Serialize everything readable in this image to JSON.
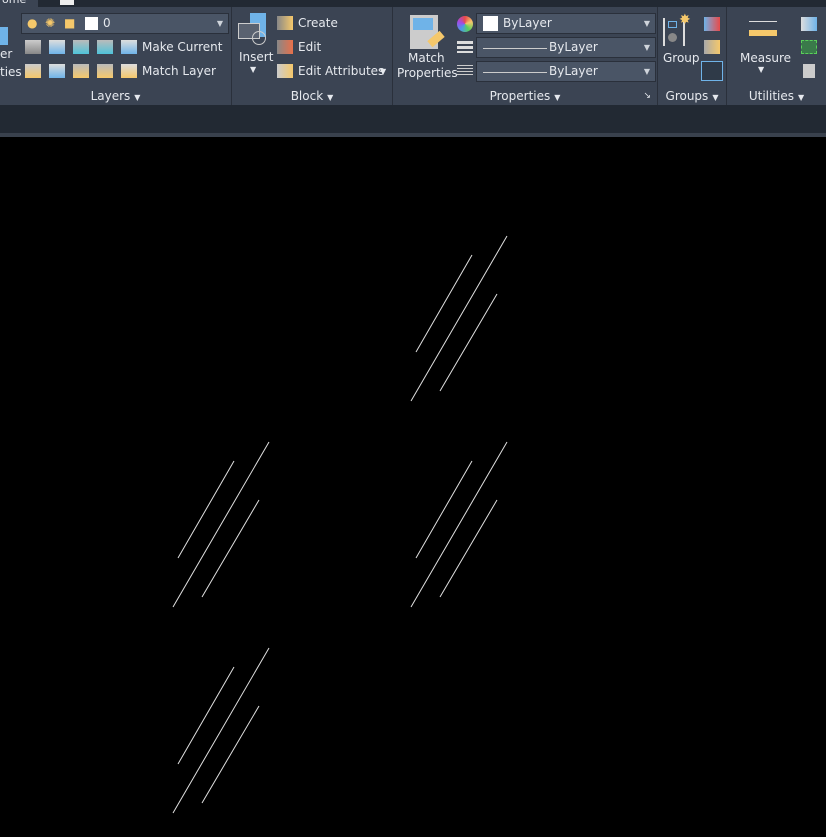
{
  "tabs": {
    "home": "ome"
  },
  "layers": {
    "panel_label": "Layers",
    "layer_value": "0",
    "make_current": "Make Current",
    "match_layer": "Match Layer",
    "layer_props_partial_1": "er",
    "layer_props_partial_2": "ties"
  },
  "block": {
    "panel_label": "Block",
    "insert": "Insert",
    "create": "Create",
    "edit": "Edit",
    "edit_attributes": "Edit Attributes"
  },
  "properties": {
    "panel_label": "Properties",
    "match_properties_1": "Match",
    "match_properties_2": "Properties",
    "color": "ByLayer",
    "lineweight": "ByLayer",
    "linetype": "ByLayer"
  },
  "groups": {
    "panel_label": "Groups",
    "group": "Group"
  },
  "utilities": {
    "panel_label": "Utilities",
    "measure": "Measure"
  },
  "colors": {
    "ribbon": "#3b4453",
    "canvas": "#000000",
    "accent": "#6fb3e8",
    "line": "#e0e0e0"
  }
}
